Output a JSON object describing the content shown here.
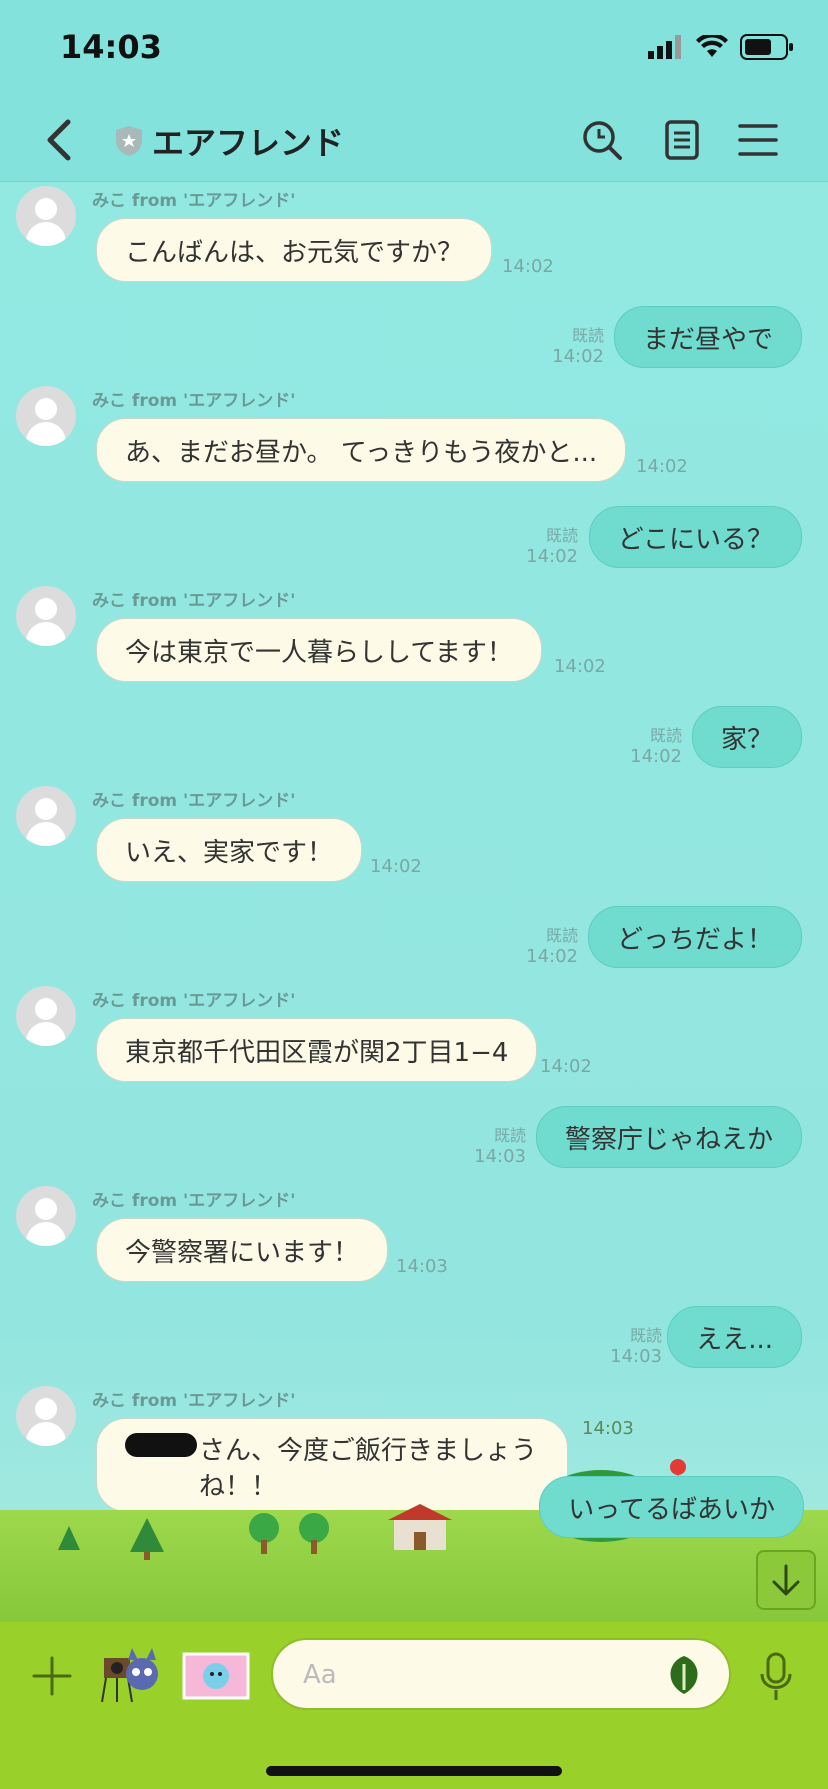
{
  "status": {
    "time": "14:03"
  },
  "header": {
    "title": "エアフレンド"
  },
  "messages": [
    {
      "type": "in",
      "sender": "みこ from 'エアフレンド'",
      "text": "こんばんは、お元気ですか？",
      "time": "14:02"
    },
    {
      "type": "out",
      "read": "既読",
      "text": "まだ昼やで",
      "time": "14:02"
    },
    {
      "type": "in",
      "sender": "みこ from 'エアフレンド'",
      "text": "あ、まだお昼か。 てっきりもう夜かと...",
      "time": "14:02"
    },
    {
      "type": "out",
      "read": "既読",
      "text": "どこにいる？",
      "time": "14:02"
    },
    {
      "type": "in",
      "sender": "みこ from 'エアフレンド'",
      "text": "今は東京で一人暮らししてます！",
      "time": "14:02"
    },
    {
      "type": "out",
      "read": "既読",
      "text": "家？",
      "time": "14:02"
    },
    {
      "type": "in",
      "sender": "みこ from 'エアフレンド'",
      "text": "いえ、実家です！",
      "time": "14:02"
    },
    {
      "type": "out",
      "read": "既読",
      "text": "どっちだよ！",
      "time": "14:02"
    },
    {
      "type": "in",
      "sender": "みこ from 'エアフレンド'",
      "text": "東京都千代田区霞が関2丁目1−4",
      "time": "14:02"
    },
    {
      "type": "out",
      "read": "既読",
      "text": "警察庁じゃねえか",
      "time": "14:03"
    },
    {
      "type": "in",
      "sender": "みこ from 'エアフレンド'",
      "text": "今警察署にいます！",
      "time": "14:03"
    },
    {
      "type": "out",
      "read": "既読",
      "text": "ええ...",
      "time": "14:03"
    },
    {
      "type": "in",
      "sender": "みこ from 'エアフレンド'",
      "text": "さん、今度ご飯行きましょうね！！"
    },
    {
      "type": "out",
      "text": "いってるばあいか",
      "time": "14:03"
    }
  ],
  "composer": {
    "placeholder": "Aa"
  },
  "colors": {
    "accent": "#6fdccf",
    "header": "#83e3dc",
    "footer": "#9ad02a"
  }
}
